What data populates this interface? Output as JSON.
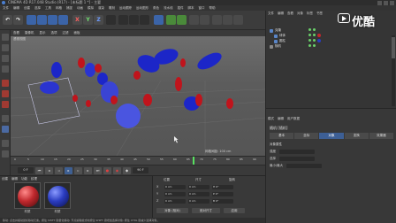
{
  "window": {
    "title": "CINEMA 4D R17.048 Studio (R17) - [未标题 1 *] - 主要"
  },
  "menubar": [
    "文件",
    "编辑",
    "创建",
    "选择",
    "工具",
    "网格",
    "捕捉",
    "动画",
    "模拟",
    "渲染",
    "雕刻",
    "运动跟踪",
    "运动图形",
    "角色",
    "流水线",
    "插件",
    "脚本",
    "窗口",
    "帮助"
  ],
  "toolbar": {
    "undo_label": "↶",
    "redo_label": "↷",
    "x_label": "X",
    "y_label": "Y",
    "z_label": "Z"
  },
  "viewport": {
    "menu": [
      "查看",
      "摄像机",
      "显示",
      "选项",
      "过滤",
      "面板"
    ],
    "label": "透视视图",
    "footer": "网格间距: 100 cm"
  },
  "timeline": {
    "ticks": [
      "0",
      "5",
      "10",
      "15",
      "20",
      "25",
      "30",
      "35",
      "40",
      "45",
      "50",
      "55",
      "60",
      "65",
      "70",
      "75",
      "80",
      "85",
      "90"
    ],
    "current_frame": "0 F",
    "end_frame": "90 F"
  },
  "materials": {
    "menu": [
      "创建",
      "编辑",
      "功能",
      "纹理"
    ],
    "items": [
      {
        "name": "材质",
        "color": "#c0282d"
      },
      {
        "name": "材质",
        "color": "#2a3cc0"
      }
    ]
  },
  "coords": {
    "headers": [
      "位置",
      "尺寸",
      "旋转"
    ],
    "rows": [
      {
        "axis": "X",
        "pos": "0 cm",
        "size": "0 cm",
        "rot": "H 0°"
      },
      {
        "axis": "Y",
        "pos": "0 cm",
        "size": "0 cm",
        "rot": "P 0°"
      },
      {
        "axis": "Z",
        "pos": "0 cm",
        "size": "0 cm",
        "rot": "B 0°"
      }
    ],
    "mode_label": "对象 (相对)",
    "size_mode_label": "绝对尺寸",
    "apply_label": "应用"
  },
  "objects": {
    "menu": [
      "文件",
      "编辑",
      "查看",
      "对象",
      "标签",
      "书签"
    ],
    "items": [
      "克隆",
      "球体",
      "圆柱",
      "随机"
    ]
  },
  "attributes": {
    "menu": [
      "模式",
      "编辑",
      "用户数据"
    ],
    "title": "随机 [随机]",
    "tabs": [
      "基本",
      "坐标",
      "对象",
      "变换",
      "效果器"
    ],
    "active_tab": "对象",
    "section": "对象属性",
    "fields": [
      "强度",
      "选择",
      "最小/最大"
    ]
  },
  "statusbar": {
    "text": "移动: 点击并拖动鼠标移动元素。按住 SHIFT 键量化移动; 节点编辑模式时按住 SHIFT 键增加选择对象; 按住 CTRL 键减少选择对象。"
  },
  "watermark": {
    "text": "优酷"
  },
  "colors": {
    "red": "#b8121a",
    "blue": "#1a22c4",
    "accent": "#3d5f95"
  }
}
